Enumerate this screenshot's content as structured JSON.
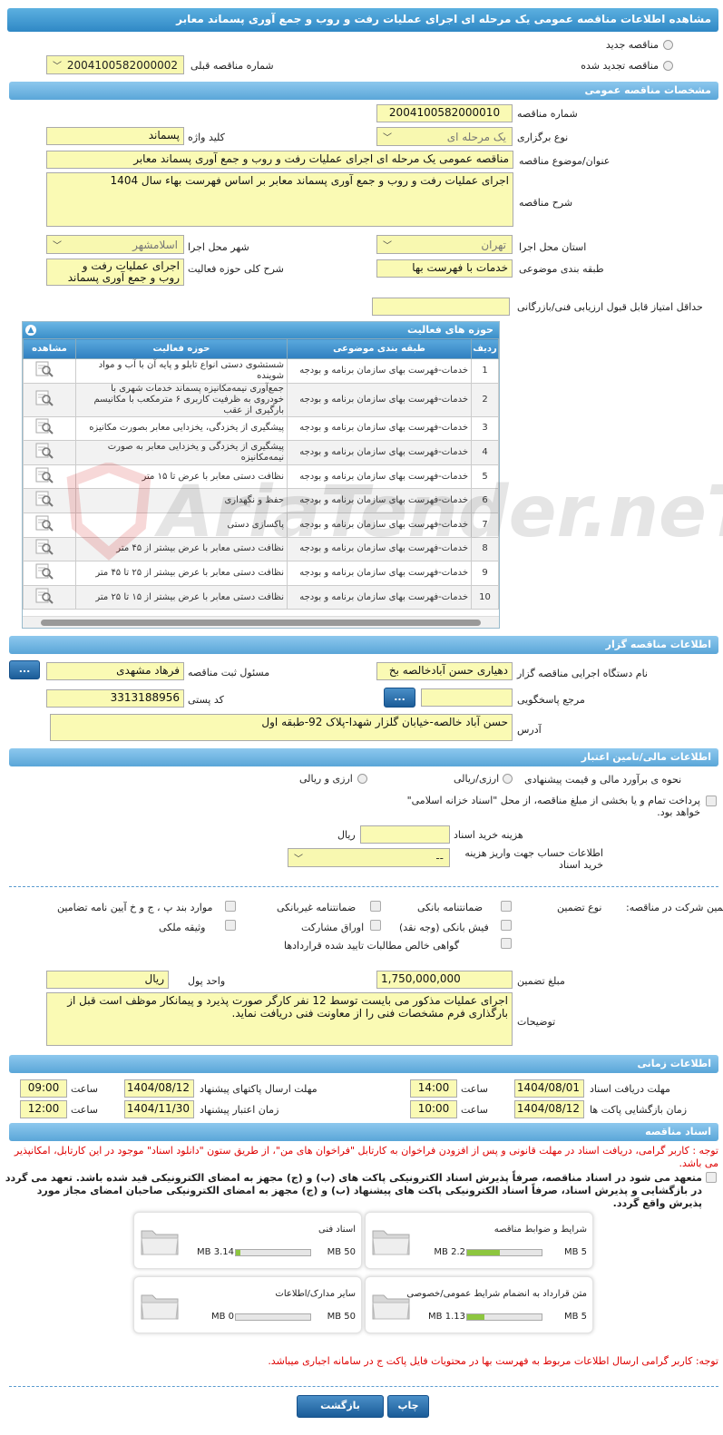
{
  "header": {
    "title": "مشاهده اطلاعات مناقصه عمومی یک مرحله ای اجرای عملیات رفت و روب و جمع آوری پسماند معابر"
  },
  "top": {
    "new_tender_label": "مناقصه جدید",
    "renewed_tender_label": "مناقصه تجدید شده",
    "prev_number_label": "شماره مناقصه قبلی",
    "prev_number_value": "2004100582000002"
  },
  "general": {
    "section_title": "مشخصات مناقصه عمومی",
    "number_label": "شماره مناقصه",
    "number_value": "2004100582000010",
    "type_label": "نوع برگزاری",
    "type_value": "یک مرحله ای",
    "keyword_label": "کلید واژه",
    "keyword_value": "پسماند",
    "subject_label": "عنوان/موضوع مناقصه",
    "subject_value": "مناقصه عمومی یک مرحله ای اجرای عملیات رفت و روب و جمع آوری پسماند معابر",
    "desc_label": "شرح مناقصه",
    "desc_value": "اجرای عملیات رفت و روب و جمع آوری پسماند معابر  بر اساس فهرست بهاء سال 1404",
    "province_label": "استان محل اجرا",
    "province_value": "تهران",
    "city_label": "شهر محل اجرا",
    "city_value": "اسلامشهر",
    "category_label": "طبقه بندی موضوعی",
    "category_value": "خدمات با فهرست بها",
    "activity_desc_label": "شرح کلی حوزه فعالیت",
    "activity_desc_value": "اجرای عملیات رفت و روب و جمع آوری پسماند معابر",
    "min_score_label": "حداقل امتیاز قابل قبول ارزیابی فنی/بازرگانی",
    "min_score_value": ""
  },
  "activities": {
    "title": "حوزه های فعالیت",
    "col_row": "ردیف",
    "col_category": "طبقه بندی موضوعی",
    "col_field": "حوزه فعالیت",
    "col_view": "مشاهده",
    "rows": [
      {
        "n": "1",
        "cat": "خدمات-فهرست بهای سازمان برنامه و بودجه",
        "field": "شستشوی دستی انواع تابلو و پایه آن با آب و مواد شوینده"
      },
      {
        "n": "2",
        "cat": "خدمات-فهرست بهای سازمان برنامه و بودجه",
        "field": "جمع‌آوری نیمه‌مکانیزه پسماند خدمات شهری با خودروی به ظرفیت کاربری ۶ مترمکعب با مکانیسم بارگیری از عقب"
      },
      {
        "n": "3",
        "cat": "خدمات-فهرست بهای سازمان برنامه و بودجه",
        "field": "پیشگیری از یخزدگی، یخزدایی معابر بصورت مکانیزه"
      },
      {
        "n": "4",
        "cat": "خدمات-فهرست بهای سازمان برنامه و بودجه",
        "field": "پیشگیری از یخزدگی و یخزدایی معابر به صورت نیمه‌مکانیزه"
      },
      {
        "n": "5",
        "cat": "خدمات-فهرست بهای سازمان برنامه و بودجه",
        "field": "نظافت دستی معابر با عرض تا ۱۵ متر"
      },
      {
        "n": "6",
        "cat": "خدمات-فهرست بهای سازمان برنامه و بودجه",
        "field": "حفظ و نگهداری"
      },
      {
        "n": "7",
        "cat": "خدمات-فهرست بهای سازمان برنامه و بودجه",
        "field": "پاکسازی دستی"
      },
      {
        "n": "8",
        "cat": "خدمات-فهرست بهای سازمان برنامه و بودجه",
        "field": "نظافت دستی معابر با عرض بیشتر از ۴۵ متر"
      },
      {
        "n": "9",
        "cat": "خدمات-فهرست بهای سازمان برنامه و بودجه",
        "field": "نظافت دستی معابر با عرض بیشتر از ۲۵ تا ۴۵ متر"
      },
      {
        "n": "10",
        "cat": "خدمات-فهرست بهای سازمان برنامه و بودجه",
        "field": "نظافت دستی معابر با عرض بیشتر از ۱۵ تا ۲۵ متر"
      }
    ]
  },
  "organizer": {
    "section_title": "اطلاعات مناقصه گزار",
    "org_label": "نام دستگاه اجرایی مناقصه گزار",
    "org_value": "دهیاری حسن آبادخالصه بخ",
    "officer_label": "مسئول ثبت مناقصه",
    "officer_value": "فرهاد مشهدی",
    "dots": "...",
    "ref_label": "مرجع پاسخگویی",
    "ref_value": "",
    "postal_label": "کد پستی",
    "postal_value": "3313188956",
    "address_label": "آدرس",
    "address_value": "حسن آباد خالصه-خیابان گلزار شهدا-پلاک 92-طبقه اول"
  },
  "finance": {
    "section_title": "اطلاعات مالی/تامین اعتبار",
    "estimate_label": "نحوه ی برآورد مالی و قیمت پیشنهادی",
    "opt_rial": "ارزی/ریالی",
    "opt_fx_rial": "ارزی و ریالی",
    "treasury_text": "پرداخت تمام و یا بخشی از مبلغ مناقصه، از محل \"اسناد خزانه اسلامی\" خواهد بود.",
    "doc_fee_label": "هزینه خرید اسناد",
    "doc_fee_unit": "ریال",
    "account_label": "اطلاعات حساب جهت واریز هزینه خرید اسناد",
    "account_value": "--"
  },
  "guarantee": {
    "participation_label": "تضمین شرکت در مناقصه:",
    "type_label": "نوع تضمین",
    "opt_bank": "ضمانتنامه بانکی",
    "opt_nonbank": "ضمانتنامه غیربانکی",
    "opt_items": "موارد بند پ ، ج و خ آیین نامه تضامین",
    "opt_receipt": "فیش بانکی (وجه نقد)",
    "opt_bonds": "اوراق مشارکت",
    "opt_property": "وثیقه ملکی",
    "opt_cert": "گواهی خالص مطالبات تایید شده قراردادها",
    "amount_label": "مبلغ تضمین",
    "amount_value": "1,750,000,000",
    "currency_label": "واحد پول",
    "currency_value": "ریال",
    "notes_label": "توضیحات",
    "notes_value": "اجرای عملیات مذکور می بایست توسط 12 نفر کارگر صورت پذیرد و پیمانکار موظف است قبل از بارگذاری فرم مشخصات فنی را از معاونت فنی دریافت  نماید."
  },
  "timing": {
    "section_title": "اطلاعات زمانی",
    "doc_deadline_label": "مهلت دریافت اسناد",
    "doc_deadline_date": "1404/08/01",
    "doc_deadline_time": "14:00",
    "send_label": "مهلت ارسال پاکتهای پیشنهاد",
    "send_date": "1404/08/12",
    "send_time": "09:00",
    "open_label": "زمان بازگشایی پاکت ها",
    "open_date": "1404/08/12",
    "open_time": "10:00",
    "validity_label": "زمان اعتبار پیشنهاد",
    "validity_date": "1404/11/30",
    "validity_time": "12:00",
    "time_label": "ساعت"
  },
  "docs": {
    "section_title": "اسناد مناقصه",
    "note1": "توجه : کاربر گرامی، دریافت اسناد در مهلت قانونی و پس از افزودن فراخوان به کارتابل \"فراخوان های من\"، از طریق ستون \"دانلود اسناد\" موجود در این کارتابل، امکانپذیر می باشد.",
    "commit": "متعهد می شود در اسناد مناقصه، صرفاً پذیرش اسناد الکترونیکی پاکت های (ب) و (ج) مجهز به امضای الکترونیکی قید شده باشد. تعهد می گردد در بازگشایی و پذیرش اسناد، صرفاً اسناد الکترونیکی پاکت های پیشنهاد (ب) و (ج) مجهز به امضای الکترونیکی صاحبان امضای مجاز مورد پذیرش واقع گردد.",
    "files": [
      {
        "name": "شرایط و ضوابط مناقصه",
        "size": "2.2 MB",
        "max": "5 MB",
        "fill": 0.44
      },
      {
        "name": "اسناد فنی",
        "size": "3.14 MB",
        "max": "50 MB",
        "fill": 0.063
      },
      {
        "name": "متن قرارداد به انضمام شرایط عمومی/خصوصی",
        "size": "1.13 MB",
        "max": "5 MB",
        "fill": 0.226
      },
      {
        "name": "سایر مدارک/اطلاعات",
        "size": "0 MB",
        "max": "50 MB",
        "fill": 0
      }
    ],
    "note2": "توجه: کاربر گرامی ارسال اطلاعات مربوط به فهرست بها در محتویات فایل پاکت ج در سامانه اجباری میباشد."
  },
  "actions": {
    "print": "چاپ",
    "back": "بازگشت"
  },
  "watermark": "AriaTender.neT",
  "colors": {
    "accent": "#2f88c5",
    "field": "#fafab4"
  }
}
